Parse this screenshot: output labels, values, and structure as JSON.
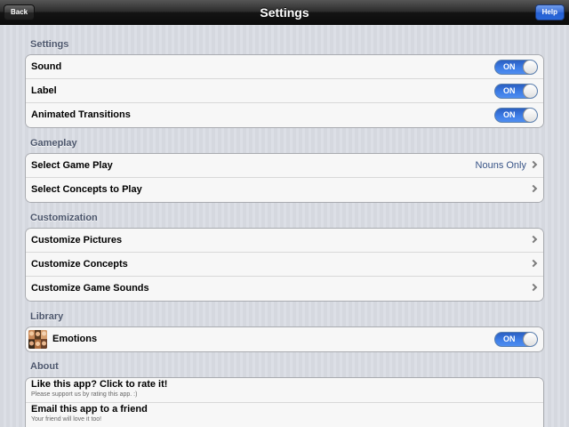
{
  "navbar": {
    "title": "Settings",
    "back_label": "Back",
    "help_label": "Help"
  },
  "sections": {
    "settings": {
      "header": "Settings",
      "rows": [
        {
          "label": "Sound",
          "toggle": "ON"
        },
        {
          "label": "Label",
          "toggle": "ON"
        },
        {
          "label": "Animated Transitions",
          "toggle": "ON"
        }
      ]
    },
    "gameplay": {
      "header": "Gameplay",
      "rows": [
        {
          "label": "Select Game Play",
          "detail": "Nouns Only"
        },
        {
          "label": "Select Concepts to Play"
        }
      ]
    },
    "customization": {
      "header": "Customization",
      "rows": [
        {
          "label": "Customize Pictures"
        },
        {
          "label": "Customize Concepts"
        },
        {
          "label": "Customize Game Sounds"
        }
      ]
    },
    "library": {
      "header": "Library",
      "rows": [
        {
          "label": "Emotions",
          "toggle": "ON",
          "thumbnail": "emotions-thumbnail-icon"
        }
      ]
    },
    "about": {
      "header": "About",
      "rows": [
        {
          "title": "Like this app? Click to rate it!",
          "subtitle": "Please support us by rating this app. :)"
        },
        {
          "title": "Email this app to a friend",
          "subtitle": "Your friend will love it too!"
        }
      ]
    }
  },
  "colors": {
    "toggle_on": "#3d7de6",
    "detail_text": "#385487",
    "section_header": "#4c566c",
    "help_button": "#2a67d9"
  }
}
